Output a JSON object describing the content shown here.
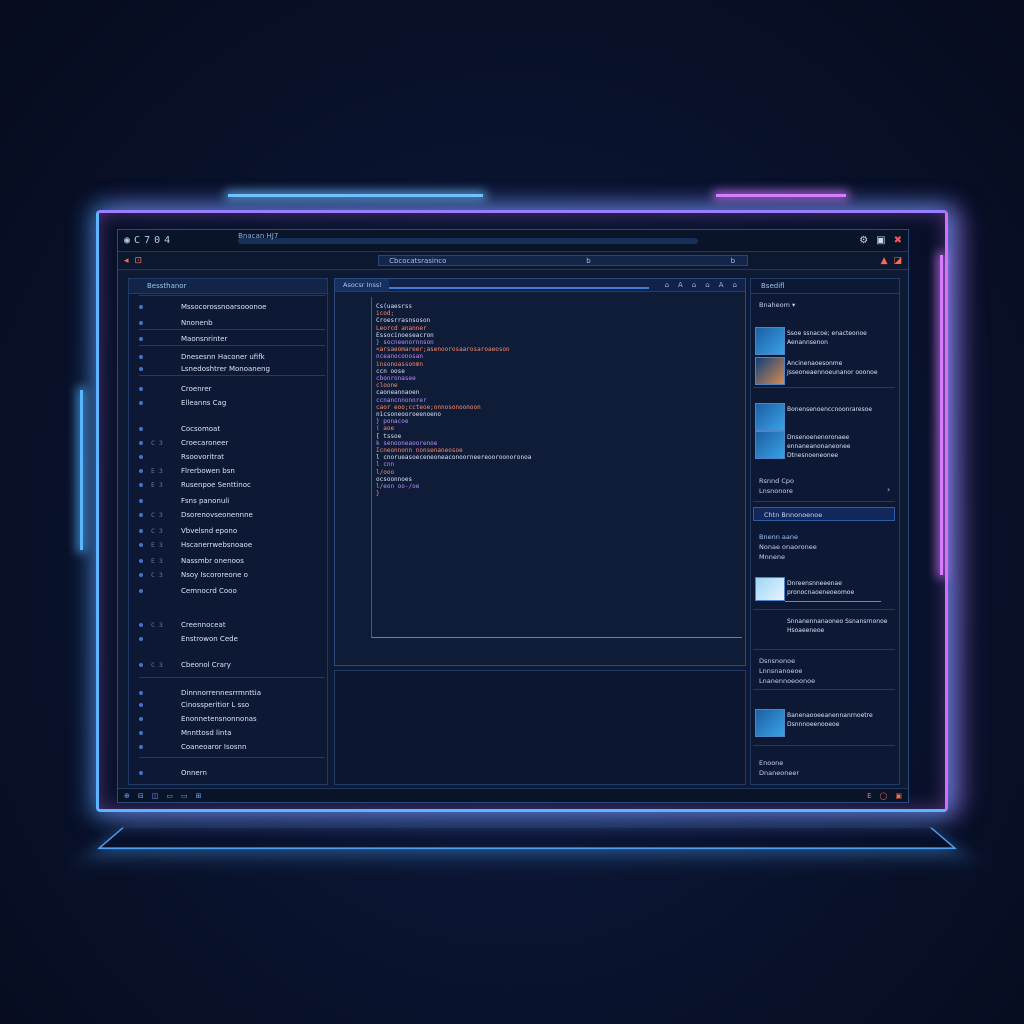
{
  "colors": {
    "accent_blue": "#5fb4ff",
    "accent_pink": "#d77cff",
    "code_keyword": "#ff8a6a",
    "code_string": "#b98cff",
    "close": "#ff4d5e"
  },
  "titlebar": {
    "left_icons": [
      "◉",
      "C",
      "7",
      "0",
      "4"
    ],
    "title": "Bnacan HJ7",
    "right_icons": [
      "gear-icon",
      "windows-icon",
      "close-icon"
    ]
  },
  "toolbar": {
    "address_text": "Cbcocatsrasinco",
    "address_mark": "b",
    "address_mark2": "b"
  },
  "sidebar": {
    "title": "Bessthanor",
    "items": [
      {
        "num": "",
        "label": "Mssocorossnoarsooonoe"
      },
      {
        "num": "",
        "label": "Nnonenb"
      },
      {
        "num": "",
        "label": "Maonsnrinter"
      },
      {
        "num": "",
        "label": "Dnesesnn Haconer ufifk"
      },
      {
        "num": "",
        "label": "Lsnedoshtrer Monoaneng"
      },
      {
        "num": "",
        "label": "Croenrer"
      },
      {
        "num": "",
        "label": "Elleanns Cag"
      },
      {
        "num": "",
        "label": "Cocsomoat"
      },
      {
        "num": "C 3",
        "label": "Croecaroneer"
      },
      {
        "num": "",
        "label": "Rsoovoritrat"
      },
      {
        "num": "E 3",
        "label": "Flrerbowen bsn"
      },
      {
        "num": "E 3",
        "label": "Rusenpoe Senttinoc"
      },
      {
        "num": "",
        "label": "Fsns panonuli"
      },
      {
        "num": "C 3",
        "label": "Dsorenovseonennne"
      },
      {
        "num": "C 3",
        "label": "Vbvelsnd epono"
      },
      {
        "num": "E 3",
        "label": "Hscanerrwebsnoaoe"
      },
      {
        "num": "E 3",
        "label": "Nassmbr onenoos"
      },
      {
        "num": "C 3",
        "label": "Nsoy Iscororeone o"
      },
      {
        "num": "",
        "label": "Cemnocrd Cooo"
      },
      {
        "num": "C 3",
        "label": "Creennoceat"
      },
      {
        "num": "",
        "label": "Enstrowon Cede"
      },
      {
        "num": "C 3",
        "label": "Cbeonol Crary"
      },
      {
        "num": "",
        "label": "Dinnnorrennesrrmnttia"
      },
      {
        "num": "",
        "label": "Cinossperitior L sso"
      },
      {
        "num": "",
        "label": "Enonnetensnonnonas"
      },
      {
        "num": "",
        "label": "Mnnttosd linta"
      },
      {
        "num": "",
        "label": "Coaneoaror Isosnn"
      },
      {
        "num": "",
        "label": "Onnern"
      }
    ]
  },
  "editor": {
    "tab": "Asocsr Inssl",
    "tools": [
      "⌂",
      "A",
      "⌂",
      "⌂",
      "A",
      "⌂"
    ],
    "lines": [
      {
        "t": "Cs(uaesrss",
        "c": "w"
      },
      {
        "t": "  icod;",
        "c": "k"
      },
      {
        "t": "  Croesrrasnsoson",
        "c": "w"
      },
      {
        "t": "  Leorcd ananner",
        "c": "k"
      },
      {
        "t": "  Essocinoeseacron",
        "c": "w"
      },
      {
        "t": "     } socneenornnson",
        "c": "s"
      },
      {
        "t": "        <arsaeomareer;asenoorosaarosaroaeoson",
        "c": "k"
      },
      {
        "t": "         nceanoconosan",
        "c": "s"
      },
      {
        "t": "         insonoassonmn",
        "c": "k"
      },
      {
        "t": "         ccn  oose",
        "c": "w"
      },
      {
        "t": "         cbonronasee",
        "c": "s"
      },
      {
        "t": "         cloone",
        "c": "k"
      },
      {
        "t": "         caoneannaoen",
        "c": "w"
      },
      {
        "t": "         ccnancnnonnrer",
        "c": "s"
      },
      {
        "t": "         caor  eoo;ccteoe;onnosonoonoon",
        "c": "k"
      },
      {
        "t": "         nicsoneooroeenoeno",
        "c": "w"
      },
      {
        "t": "       }  ponacoe",
        "c": "s"
      },
      {
        "t": "   ( aoe",
        "c": "k"
      },
      {
        "t": "  [ tssoe",
        "c": "w"
      },
      {
        "t": "     k  senooneaoorenoe",
        "c": "s"
      },
      {
        "t": "        Icneonnonn nonsenaneosoe",
        "c": "k"
      },
      {
        "t": "        l cnorueasoeceneoneaconoorneereooroonoronoa",
        "c": "w"
      },
      {
        "t": "        l cnn",
        "c": "s"
      },
      {
        "t": "        l/ooo",
        "c": "k"
      },
      {
        "t": "             ocsoonnoes",
        "c": "w"
      },
      {
        "t": "             l/eon oo-/oe",
        "c": "s"
      },
      {
        "t": "             }",
        "c": "k"
      }
    ]
  },
  "rightpanel": {
    "title": "Bsedifl",
    "subtitle": "Bnaheom ▾",
    "cards": [
      {
        "text": "Ssoe ssnacoe; enacteonoe Aenannsenon"
      },
      {
        "text": "Ancinenaoesonme Jsseoneaennoeunanor ooonoe"
      },
      {
        "text": "Bonensenoenccnoonraresoe"
      },
      {
        "text": "Dnsenoenenoronaee ennaneanonaneonee Dtnesnoeneonee"
      }
    ],
    "link1": "Rsnnd Cpo",
    "link2": "Lnsnonore",
    "button": "Chtn   Bnnonoenoe",
    "section_head": "Bnenn aane",
    "section_lines": [
      "Nonae onaoronee",
      "Mnnene"
    ],
    "card5": "Dnreensnneeenae pronocnaoeneoeomoe",
    "card6": "Snnanennanaoneo Ssnansrnonoe Hsoaeeneoe",
    "block": [
      "Dsnsnonoe",
      "Lnnsnanoeoe",
      "Lnanennoeoonoe"
    ],
    "card7": "Banenaooeeanennanrnoetre Dsnnnoeenooeoe",
    "footer": [
      "Enoone",
      "Dnaneoneer"
    ]
  },
  "statusbar": {
    "left": [
      "⊕",
      "⊟",
      "◫",
      "▭",
      "▭",
      "⊞"
    ],
    "right": [
      "Ε",
      "◯",
      "▣"
    ]
  }
}
